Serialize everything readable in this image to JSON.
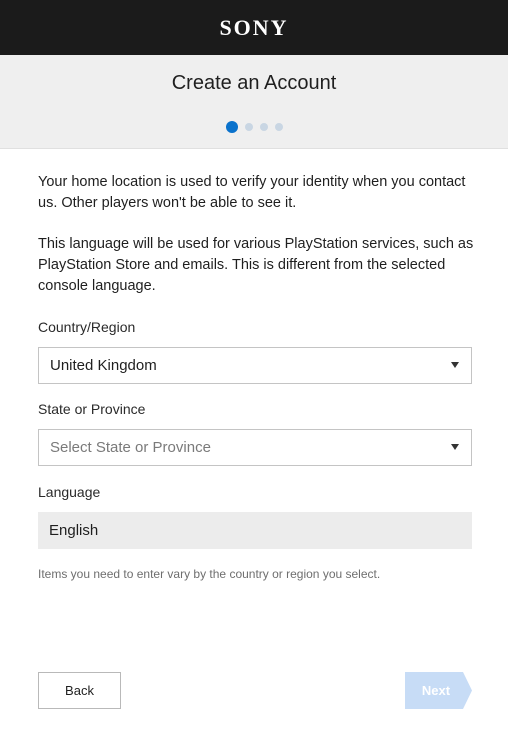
{
  "brand": {
    "logo_text": "SONY"
  },
  "header": {
    "title": "Create an Account",
    "steps_total": 4,
    "current_step": 1
  },
  "content": {
    "intro_1": "Your home location is used to verify your identity when you contact us. Other players won't be able to see it.",
    "intro_2": "This language will be used for various PlayStation services, such as PlayStation Store and emails. This is different from the selected console language.",
    "country": {
      "label": "Country/Region",
      "value": "United Kingdom"
    },
    "state": {
      "label": "State or Province",
      "placeholder": "Select State or Province"
    },
    "language": {
      "label": "Language",
      "value": "English"
    },
    "note": "Items you need to enter vary by the country or region you select."
  },
  "footer": {
    "back_label": "Back",
    "next_label": "Next",
    "next_color": "#c7dcf6"
  },
  "colors": {
    "accent": "#0a72cc",
    "topbar": "#1b1b1b",
    "header_bg": "#efefef"
  }
}
